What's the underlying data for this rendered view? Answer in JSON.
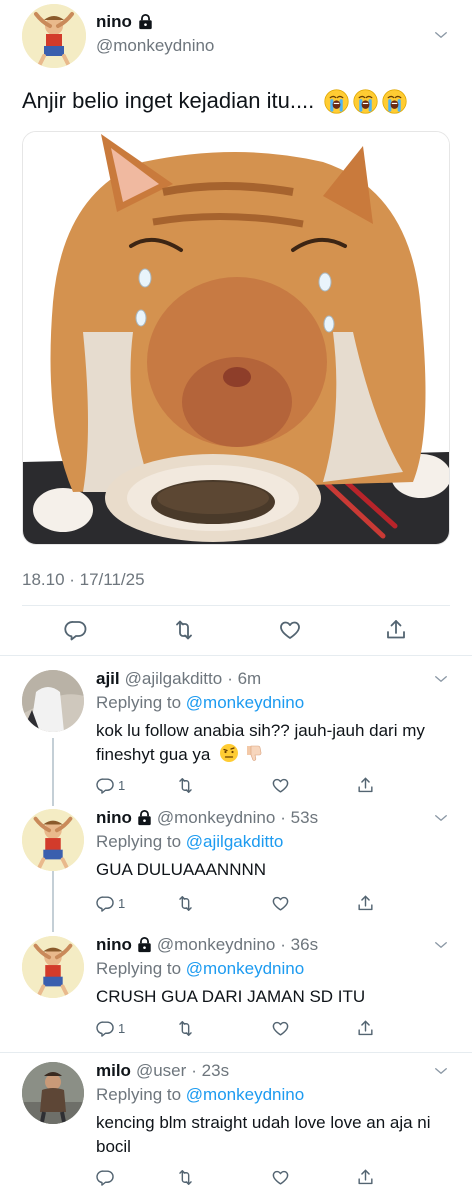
{
  "main_tweet": {
    "author_name": "nino",
    "author_handle": "@monkeydnino",
    "text": "Anjir belio inget kejadian itu....",
    "emoji_count": 3,
    "timestamp": "18.10 · 17/11/25"
  },
  "replies": [
    {
      "name": "ajil",
      "handle": "@ajilgakditto",
      "time": "· 6m",
      "replying_prefix": "Replying to ",
      "replying_to": "@monkeydnino",
      "text": "kok lu follow anabia sih?? jauh-jauh dari my fineshyt gua ya",
      "reply_count": "1",
      "locked": false
    },
    {
      "name": "nino",
      "handle": "@monkeydnino",
      "time": "· 53s",
      "replying_prefix": "Replying to ",
      "replying_to": "@ajilgakditto",
      "text": "GUA DULUAAANNNN",
      "reply_count": "1",
      "locked": true
    },
    {
      "name": "nino",
      "handle": "@monkeydnino",
      "time": "· 36s",
      "replying_prefix": "Replying to ",
      "replying_to": "@monkeydnino",
      "text": "CRUSH GUA DARI JAMAN SD ITU",
      "reply_count": "1",
      "locked": true
    },
    {
      "name": "milo",
      "handle": "@user",
      "time": "· 23s",
      "replying_prefix": "Replying to ",
      "replying_to": "@monkeydnino",
      "text": "kencing blm straight udah love love an aja ni bocil",
      "reply_count": "",
      "locked": false
    }
  ],
  "colors": {
    "accent": "#1d9bf0",
    "secondary_text": "#6e767d",
    "divider": "#e6ecf0"
  },
  "icons": [
    "lock-icon",
    "chevron-down-icon",
    "reply-icon",
    "retweet-icon",
    "like-icon",
    "share-icon",
    "crying-emoji-icon",
    "raised-eyebrow-emoji-icon",
    "thumbs-down-emoji-icon"
  ]
}
